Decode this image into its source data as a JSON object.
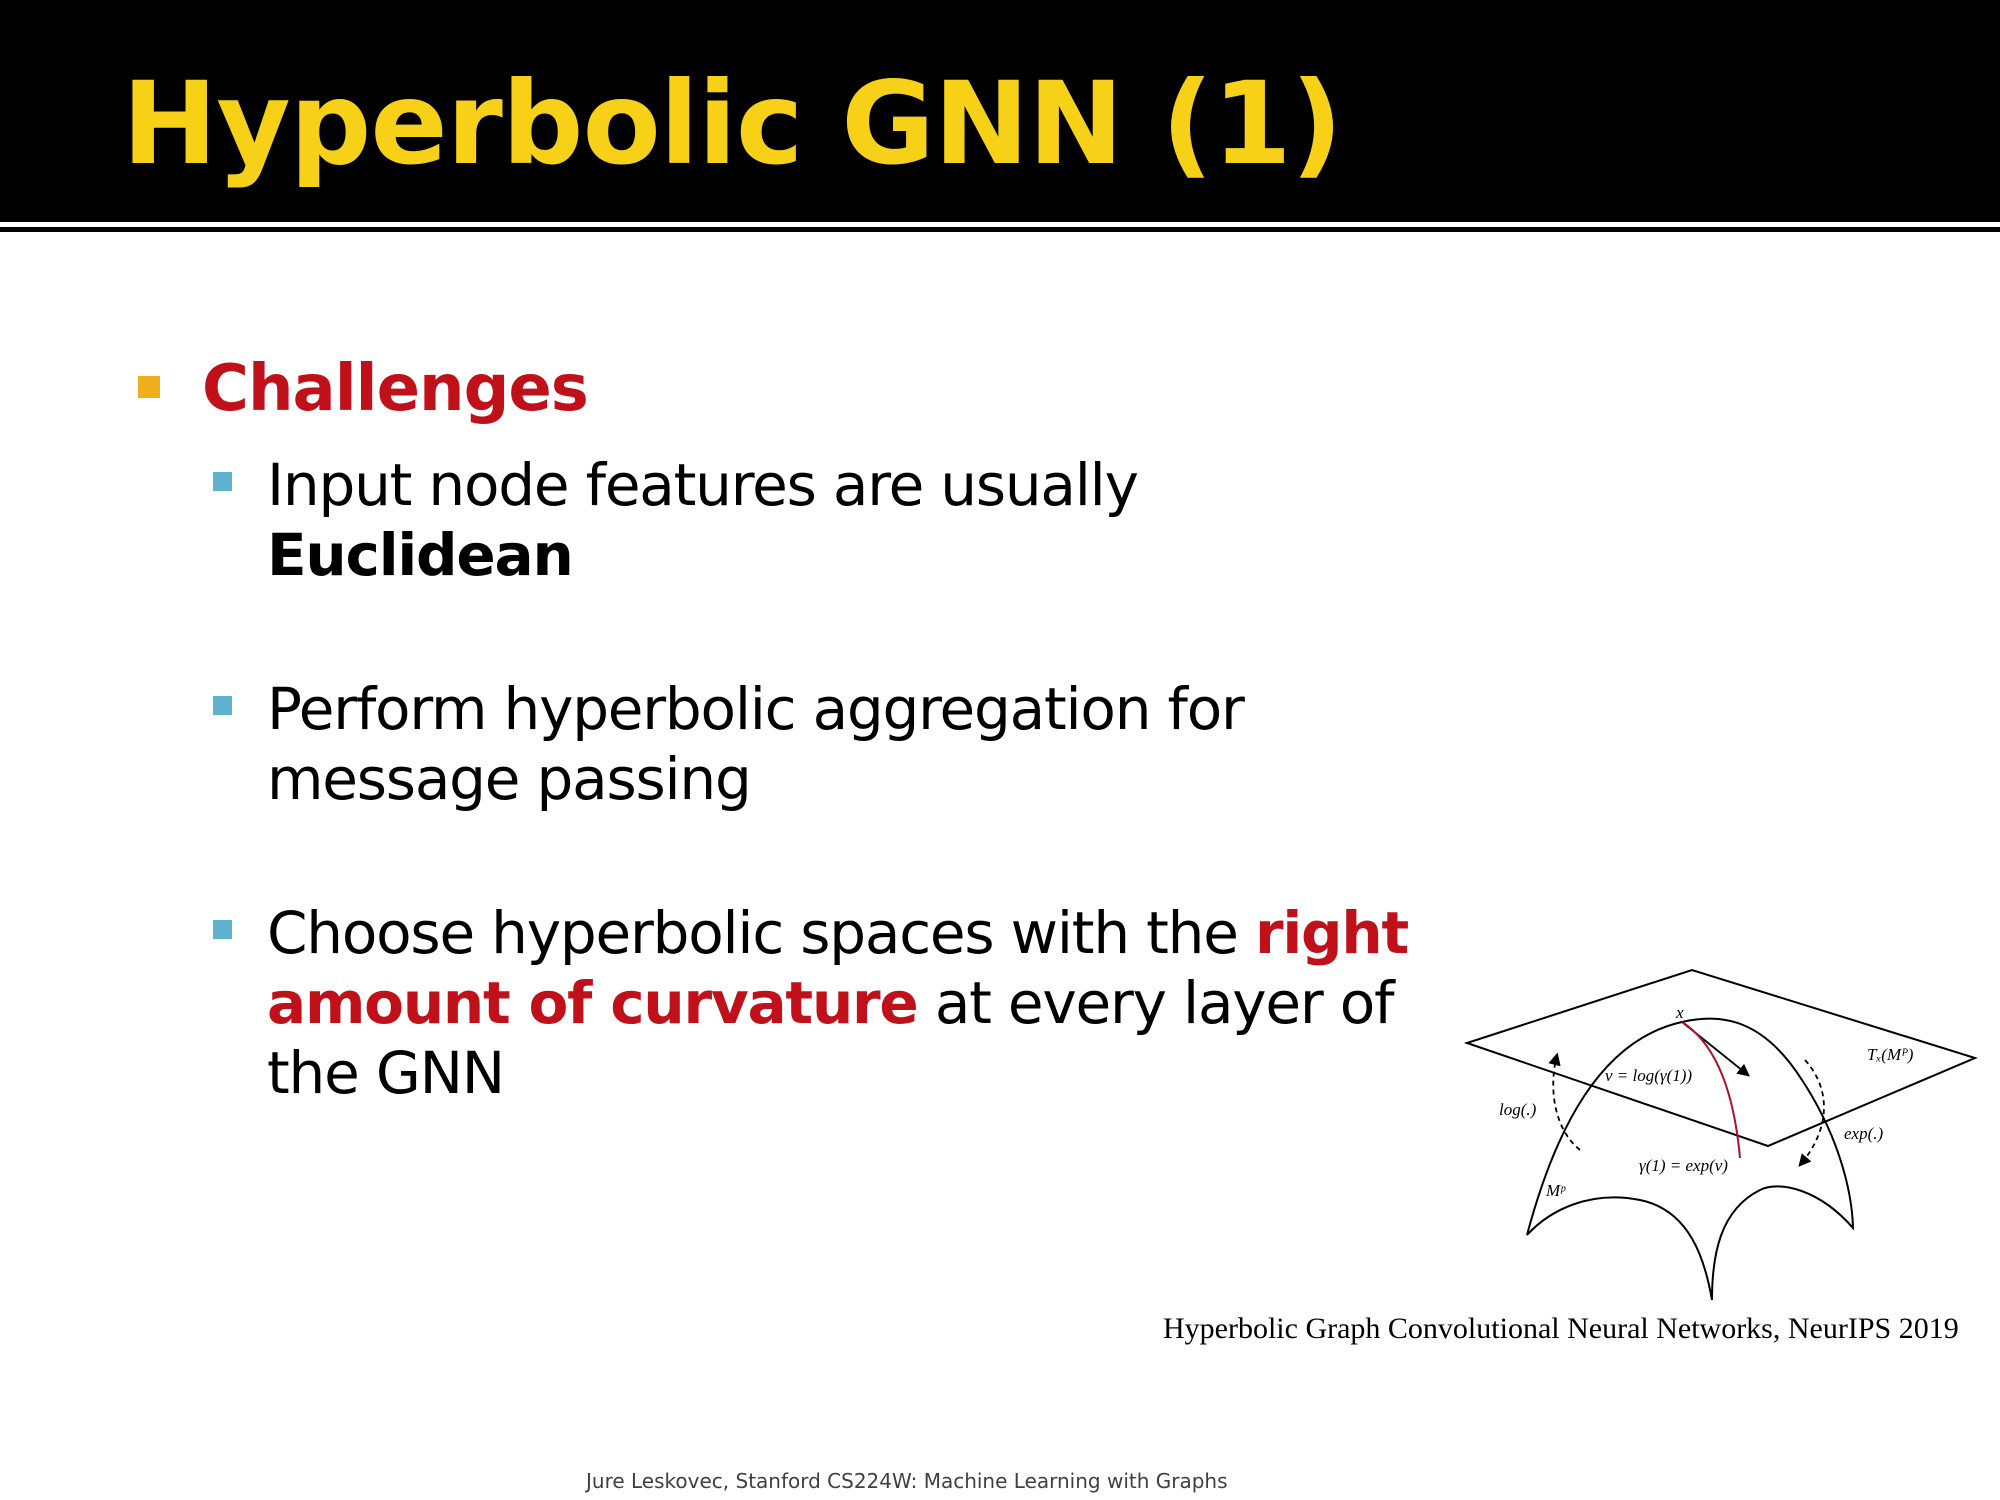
{
  "slide": {
    "title": "Hyperbolic GNN (1)",
    "heading": "Challenges",
    "bullets": [
      {
        "line1": "Input node features are usually",
        "line2_bold": "Euclidean"
      },
      {
        "line1": "Perform hyperbolic aggregation for",
        "line2": "message passing"
      },
      {
        "line1_plain": "Choose hyperbolic spaces with the ",
        "line1_red": "right",
        "line2_red": "amount of curvature",
        "line2_plain": " at every layer of",
        "line3": "the GNN"
      }
    ]
  },
  "figure": {
    "labels": {
      "x": "x",
      "tangent": "Tₓ(Mᴾ)",
      "v": "v = log(γ(1))",
      "log": "log(.)",
      "exp": "exp(.)",
      "gamma": "γ(1) = exp(v)",
      "manifold": "Mᵖ"
    },
    "caption": "Hyperbolic Graph Convolutional Neural Networks, NeurIPS 2019"
  },
  "footer": "Jure Leskovec, Stanford CS224W: Machine Learning with Graphs",
  "colors": {
    "title": "#f7d117",
    "title_bar": "#000000",
    "accent_red": "#c0101a",
    "main_bullet": "#f0ae1a",
    "sub_bullet": "#5fb3cf"
  }
}
